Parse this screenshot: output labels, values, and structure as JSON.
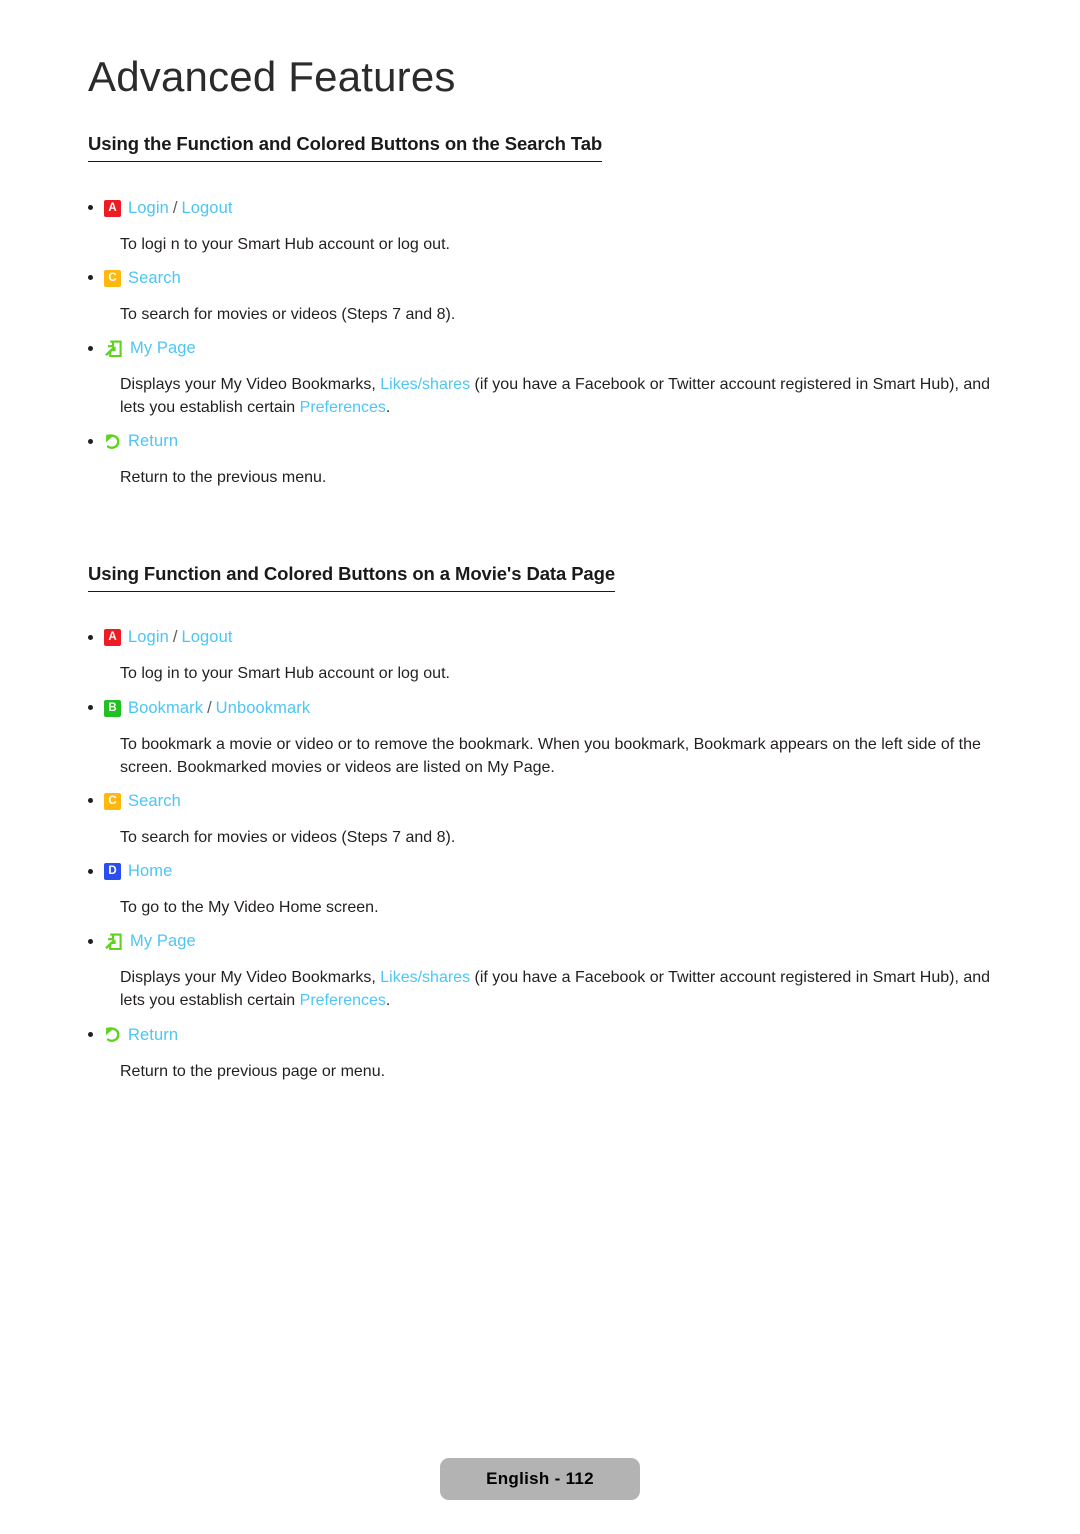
{
  "chapter": {
    "title": "Advanced Features"
  },
  "sections": [
    {
      "heading": "Using the Function and Colored Buttons on the Search Tab",
      "items": [
        {
          "icon": "key-a-icon",
          "icon_type": "key",
          "key_letter": "A",
          "key_color": "#ed1c24",
          "term": "Login",
          "separator": "/",
          "term2": "Logout",
          "desc_parts": [
            {
              "text": "To logi n to your Smart Hub account or log out.",
              "link": false
            }
          ]
        },
        {
          "icon": "key-c-icon",
          "icon_type": "key",
          "key_letter": "C",
          "key_color": "#ffb80d",
          "term": "Search",
          "separator": "",
          "term2": "",
          "desc_parts": [
            {
              "text": "To search for movies or videos (Steps 7 and 8).",
              "link": false
            }
          ]
        },
        {
          "icon": "my-page-icon",
          "icon_type": "mypage",
          "key_letter": "",
          "key_color": "#5ed31e",
          "term": "My Page",
          "separator": "",
          "term2": "",
          "desc_parts": [
            {
              "text": "Displays your My Video Bookmarks, ",
              "link": false
            },
            {
              "text": "Likes/shares",
              "link": true
            },
            {
              "text": " (if you have a Facebook or Twitter account registered in Smart Hub), and lets you establish certain ",
              "link": false
            },
            {
              "text": "Preferences",
              "link": true
            },
            {
              "text": ".",
              "link": false
            }
          ]
        },
        {
          "icon": "return-icon",
          "icon_type": "return",
          "key_letter": "",
          "key_color": "#5ed31e",
          "term": "Return",
          "separator": "",
          "term2": "",
          "desc_parts": [
            {
              "text": "Return to the previous menu.",
              "link": false
            }
          ]
        }
      ]
    },
    {
      "heading": "Using Function and Colored Buttons on a Movie's Data Page",
      "items": [
        {
          "icon": "key-a-icon",
          "icon_type": "key",
          "key_letter": "A",
          "key_color": "#ed1c24",
          "term": "Login",
          "separator": "/",
          "term2": "Logout",
          "desc_parts": [
            {
              "text": "To log in to your Smart Hub account or log out.",
              "link": false
            }
          ]
        },
        {
          "icon": "key-b-icon",
          "icon_type": "key",
          "key_letter": "B",
          "key_color": "#22c122",
          "term": "Bookmark",
          "separator": "/",
          "term2": "Unbookmark",
          "desc_parts": [
            {
              "text": "To bookmark a movie or video or to remove the bookmark. When you bookmark, Bookmark appears on the left side of the screen. Bookmarked movies or videos are listed on My Page.",
              "link": false
            }
          ]
        },
        {
          "icon": "key-c-icon",
          "icon_type": "key",
          "key_letter": "C",
          "key_color": "#ffb80d",
          "term": "Search",
          "separator": "",
          "term2": "",
          "desc_parts": [
            {
              "text": "To search for movies or videos (Steps 7 and 8).",
              "link": false
            }
          ]
        },
        {
          "icon": "key-d-icon",
          "icon_type": "key",
          "key_letter": "D",
          "key_color": "#2b4ef0",
          "term": "Home",
          "separator": "",
          "term2": "",
          "desc_parts": [
            {
              "text": "To go to the My Video Home screen.",
              "link": false
            }
          ]
        },
        {
          "icon": "my-page-icon",
          "icon_type": "mypage",
          "key_letter": "",
          "key_color": "#5ed31e",
          "term": "My Page",
          "separator": "",
          "term2": "",
          "desc_parts": [
            {
              "text": "Displays your My Video Bookmarks, ",
              "link": false
            },
            {
              "text": "Likes/shares",
              "link": true
            },
            {
              "text": " (if you have a Facebook or Twitter account registered in Smart Hub), and lets you establish certain ",
              "link": false
            },
            {
              "text": "Preferences",
              "link": true
            },
            {
              "text": ".",
              "link": false
            }
          ]
        },
        {
          "icon": "return-icon",
          "icon_type": "return",
          "key_letter": "",
          "key_color": "#5ed31e",
          "term": "Return",
          "separator": "",
          "term2": "",
          "desc_parts": [
            {
              "text": "Return to the previous page or menu.",
              "link": false
            }
          ]
        }
      ]
    }
  ],
  "footer": {
    "label": "English - 112"
  },
  "colors": {
    "link": "#4cc6f4",
    "body_text": "#231f20",
    "green_icon": "#5ed31e",
    "footer_badge_bg": "#b3b3b3"
  }
}
